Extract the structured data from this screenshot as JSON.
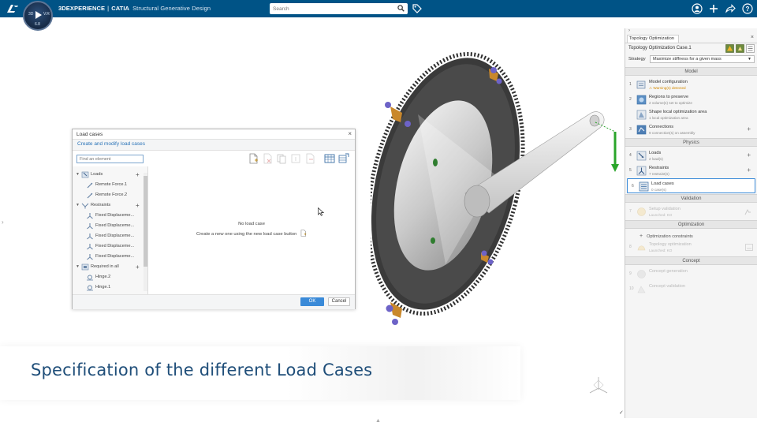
{
  "topbar": {
    "brand": "3DEXPERIENCE",
    "separator": "|",
    "product": "CATIA",
    "app_name": "Structural Generative Design",
    "search_placeholder": "Search",
    "compass": {
      "q3d": "3D",
      "qv": "V.R",
      "ver": "6.8"
    },
    "bg_color": "#005386"
  },
  "dialog": {
    "title": "Load cases",
    "close_glyph": "×",
    "subtitle": "Create and modify load cases",
    "find_placeholder": "Find an element",
    "tree": [
      {
        "label": "Loads",
        "level": 0,
        "expander": "▼",
        "icon": "loads-icon",
        "plus": "+"
      },
      {
        "label": "Remote Force.1",
        "level": 1,
        "icon": "force-icon"
      },
      {
        "label": "Remote Force.2",
        "level": 1,
        "icon": "force-icon"
      },
      {
        "label": "Restraints",
        "level": 0,
        "expander": "▼",
        "icon": "restraints-icon",
        "plus": "+"
      },
      {
        "label": "Fixed Displaceme...",
        "level": 1,
        "icon": "fixed-icon"
      },
      {
        "label": "Fixed Displaceme...",
        "level": 1,
        "icon": "fixed-icon"
      },
      {
        "label": "Fixed Displaceme...",
        "level": 1,
        "icon": "fixed-icon"
      },
      {
        "label": "Fixed Displaceme...",
        "level": 1,
        "icon": "fixed-icon"
      },
      {
        "label": "Fixed Displaceme...",
        "level": 1,
        "icon": "fixed-icon"
      },
      {
        "label": "Required in all",
        "level": 0,
        "expander": "▼",
        "icon": "required-icon",
        "plus": "+"
      },
      {
        "label": "Hinge.2",
        "level": 1,
        "icon": "hinge-icon"
      },
      {
        "label": "Hinge.1",
        "level": 1,
        "icon": "hinge-icon"
      }
    ],
    "empty_title": "No load case",
    "empty_hint": "Create a new one using the new load case button",
    "ok_label": "OK",
    "cancel_label": "Cancel"
  },
  "banner": {
    "text": "Specification of the different Load Cases"
  },
  "panel": {
    "collapse_glyph": "›",
    "tab_label": "Topology Optimization",
    "close_glyph": "×",
    "case_name": "Topology Optimization Case.1",
    "strategy_label": "Strategy",
    "strategy_value": "Maximize stiffness for a given mass",
    "sections": {
      "model": "Model",
      "physics": "Physics",
      "validation": "Validation",
      "optimization": "Optimization",
      "concept": "Concept"
    },
    "steps": [
      {
        "num": "1",
        "title": "Model configuration",
        "desc": "Warning(s) detected",
        "warn": true,
        "icon": "model-config-icon"
      },
      {
        "num": "2",
        "title": "Regions to preserve",
        "desc": "2 volume(s) set to optimize",
        "icon": "regions-icon"
      },
      {
        "num": "",
        "title": "Shape local optimization area",
        "desc": "1 local optimization area",
        "icon": "shape-area-icon"
      },
      {
        "num": "3",
        "title": "Connections",
        "desc": "9 connection(s) on assembly",
        "icon": "connections-icon",
        "plus": "+"
      },
      {
        "num": "4",
        "title": "Loads",
        "desc": "2 load(s)",
        "icon": "loads-step-icon",
        "plus": "+"
      },
      {
        "num": "5",
        "title": "Restraints",
        "desc": "7 restraint(s)",
        "icon": "restraints-step-icon",
        "plus": "+"
      },
      {
        "num": "6",
        "title": "Load cases",
        "desc": "0 case(s)",
        "icon": "load-cases-icon",
        "active": true
      },
      {
        "num": "7",
        "title": "Setup validation",
        "desc": "Launched: KO",
        "icon": "setup-validation-icon",
        "disabled": true
      },
      {
        "num": "8",
        "title": "Topology optimization",
        "desc": "Launched: KO",
        "icon": "topology-icon",
        "disabled": true
      },
      {
        "num": "9",
        "title": "Concept generation",
        "desc": "",
        "icon": "concept-generation-icon",
        "disabled": true
      },
      {
        "num": "10",
        "title": "Concept validation",
        "desc": "",
        "icon": "concept-validation-icon",
        "disabled": true
      }
    ],
    "optimization_constraints": "Optimization constraints"
  },
  "colors": {
    "accent": "#3a8ad8",
    "banner_text": "#1f4e79",
    "warning": "#d38a00",
    "load_arrow": "#2aa52a"
  }
}
